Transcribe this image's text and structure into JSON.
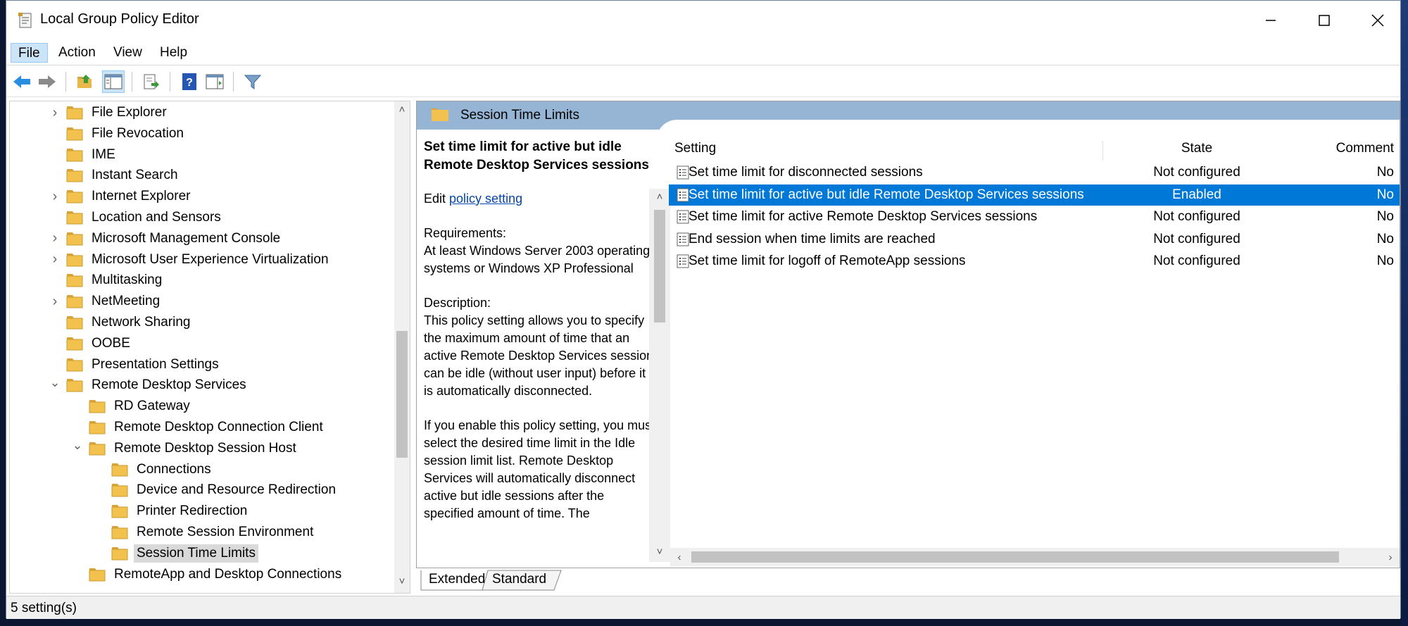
{
  "window": {
    "title": "Local Group Policy Editor"
  },
  "menu": [
    {
      "label": "File"
    },
    {
      "label": "Action"
    },
    {
      "label": "View"
    },
    {
      "label": "Help"
    }
  ],
  "tree": {
    "items": [
      {
        "label": "File Explorer",
        "level": 0,
        "expander": "collapsed"
      },
      {
        "label": "File Revocation",
        "level": 0,
        "expander": "none"
      },
      {
        "label": "IME",
        "level": 0,
        "expander": "none"
      },
      {
        "label": "Instant Search",
        "level": 0,
        "expander": "none"
      },
      {
        "label": "Internet Explorer",
        "level": 0,
        "expander": "collapsed"
      },
      {
        "label": "Location and Sensors",
        "level": 0,
        "expander": "none"
      },
      {
        "label": "Microsoft Management Console",
        "level": 0,
        "expander": "collapsed"
      },
      {
        "label": "Microsoft User Experience Virtualization",
        "level": 0,
        "expander": "collapsed"
      },
      {
        "label": "Multitasking",
        "level": 0,
        "expander": "none"
      },
      {
        "label": "NetMeeting",
        "level": 0,
        "expander": "collapsed"
      },
      {
        "label": "Network Sharing",
        "level": 0,
        "expander": "none"
      },
      {
        "label": "OOBE",
        "level": 0,
        "expander": "none"
      },
      {
        "label": "Presentation Settings",
        "level": 0,
        "expander": "none"
      },
      {
        "label": "Remote Desktop Services",
        "level": 0,
        "expander": "expanded"
      },
      {
        "label": "RD Gateway",
        "level": 1,
        "expander": "none"
      },
      {
        "label": "Remote Desktop Connection Client",
        "level": 1,
        "expander": "none"
      },
      {
        "label": "Remote Desktop Session Host",
        "level": 1,
        "expander": "expanded"
      },
      {
        "label": "Connections",
        "level": 2,
        "expander": "none"
      },
      {
        "label": "Device and Resource Redirection",
        "level": 2,
        "expander": "none"
      },
      {
        "label": "Printer Redirection",
        "level": 2,
        "expander": "none"
      },
      {
        "label": "Remote Session Environment",
        "level": 2,
        "expander": "none"
      },
      {
        "label": "Session Time Limits",
        "level": 2,
        "expander": "none",
        "selected": true
      },
      {
        "label": "RemoteApp and Desktop Connections",
        "level": 1,
        "expander": "none"
      }
    ]
  },
  "pane": {
    "header": "Session Time Limits",
    "description": {
      "title": "Set time limit for active but idle Remote Desktop Services sessions",
      "edit_prefix": "Edit ",
      "edit_link": "policy setting",
      "requirements_label": "Requirements:",
      "requirements": "At least Windows Server 2003 operating systems or Windows XP Professional",
      "description_label": "Description:",
      "description_text": "This policy setting allows you to specify the maximum amount of time that an active Remote Desktop Services session can be idle (without user input) before it is automatically disconnected.",
      "if_enable": "If you enable this policy setting, you must select the desired time limit in the Idle session limit list. Remote Desktop Services will automatically disconnect active but idle sessions after the specified amount of time. The"
    },
    "columns": {
      "setting": "Setting",
      "state": "State",
      "comment": "Comment"
    },
    "rows": [
      {
        "setting": "Set time limit for disconnected sessions",
        "state": "Not configured",
        "comment": "No"
      },
      {
        "setting": "Set time limit for active but idle Remote Desktop Services sessions",
        "state": "Enabled",
        "comment": "No",
        "selected": true
      },
      {
        "setting": "Set time limit for active Remote Desktop Services sessions",
        "state": "Not configured",
        "comment": "No"
      },
      {
        "setting": "End session when time limits are reached",
        "state": "Not configured",
        "comment": "No"
      },
      {
        "setting": "Set time limit for logoff of RemoteApp sessions",
        "state": "Not configured",
        "comment": "No"
      }
    ]
  },
  "tabs": [
    {
      "label": "Extended"
    },
    {
      "label": "Standard"
    }
  ],
  "status": {
    "text": "5 setting(s)"
  },
  "colors": {
    "selection": "#0078d7",
    "header": "#96b4d4",
    "folder": "#f2c14e"
  }
}
